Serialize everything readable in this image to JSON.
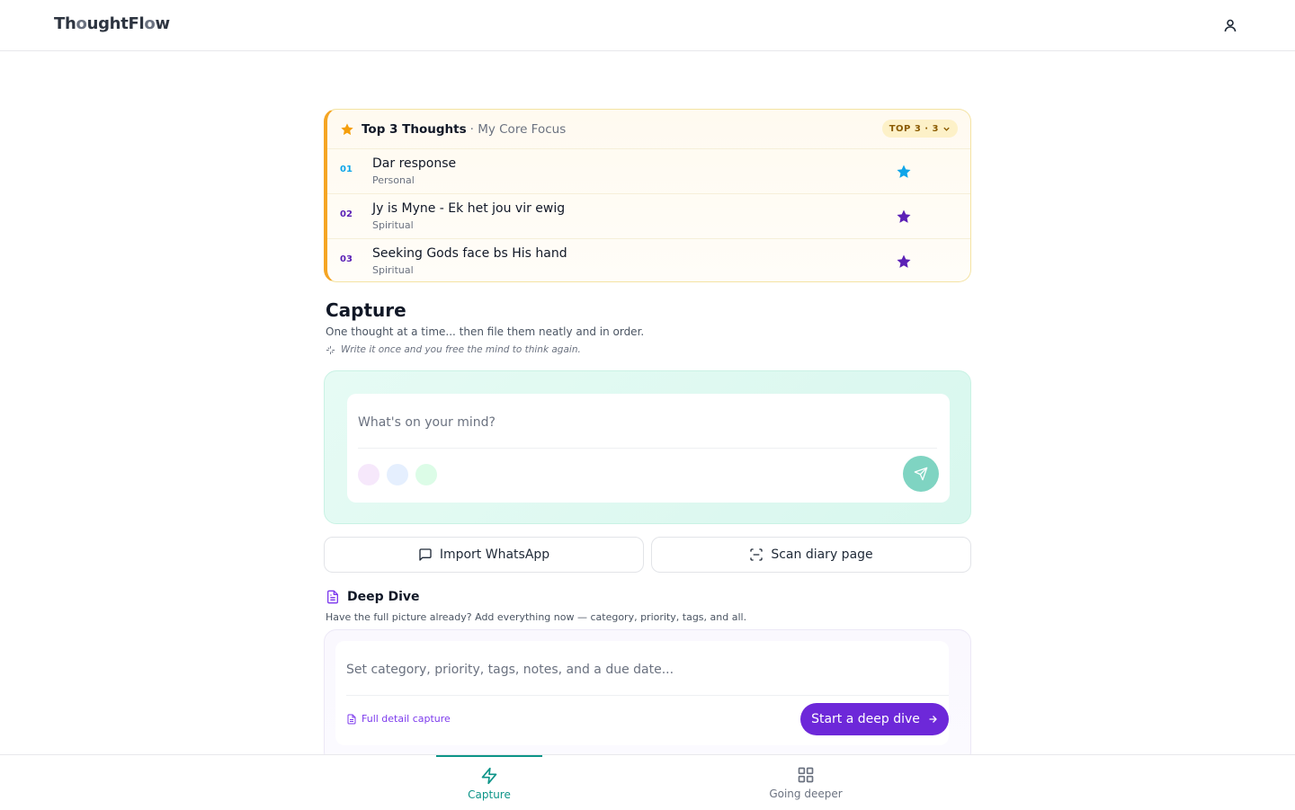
{
  "header": {
    "logo": "ThoughtFlow",
    "logo_parts": [
      "Th",
      "o",
      "ughtFl",
      "o",
      "w"
    ]
  },
  "top3": {
    "title": "Top 3 Thoughts",
    "subtitle": "· My Core Focus",
    "badge": "TOP 3 · 3",
    "items": [
      {
        "num": "01",
        "title": "Dar response",
        "category": "Personal",
        "num_color": "#0ea5e9",
        "star_color": "#0ea5e9"
      },
      {
        "num": "02",
        "title": "Jy is Myne - Ek het jou vir ewig",
        "category": "Spiritual",
        "num_color": "#5b21b6",
        "star_color": "#5b21b6"
      },
      {
        "num": "03",
        "title": "Seeking Gods face bs His hand",
        "category": "Spiritual",
        "num_color": "#5b21b6",
        "star_color": "#5b21b6"
      }
    ]
  },
  "capture": {
    "title": "Capture",
    "subtitle": "One thought at a time... then file them neatly and in order.",
    "hint": "Write it once and you free the mind to think again.",
    "placeholder": "What's on your mind?",
    "dot_colors": [
      "#f6e8fb",
      "#e5effe",
      "#dcfce7"
    ]
  },
  "actions": {
    "import_label": "Import WhatsApp",
    "scan_label": "Scan diary page"
  },
  "deep_dive": {
    "title": "Deep Dive",
    "subtitle": "Have the full picture already? Add everything now — category, priority, tags, and all.",
    "placeholder": "Set category, priority, tags, notes, and a due date...",
    "link_label": "Full detail capture",
    "button_label": "Start a deep dive"
  },
  "nav": {
    "capture_label": "Capture",
    "deeper_label": "Going deeper"
  },
  "colors": {
    "accent_teal": "#0d9488",
    "accent_purple": "#6d28d9",
    "accent_orange": "#f5a524"
  }
}
